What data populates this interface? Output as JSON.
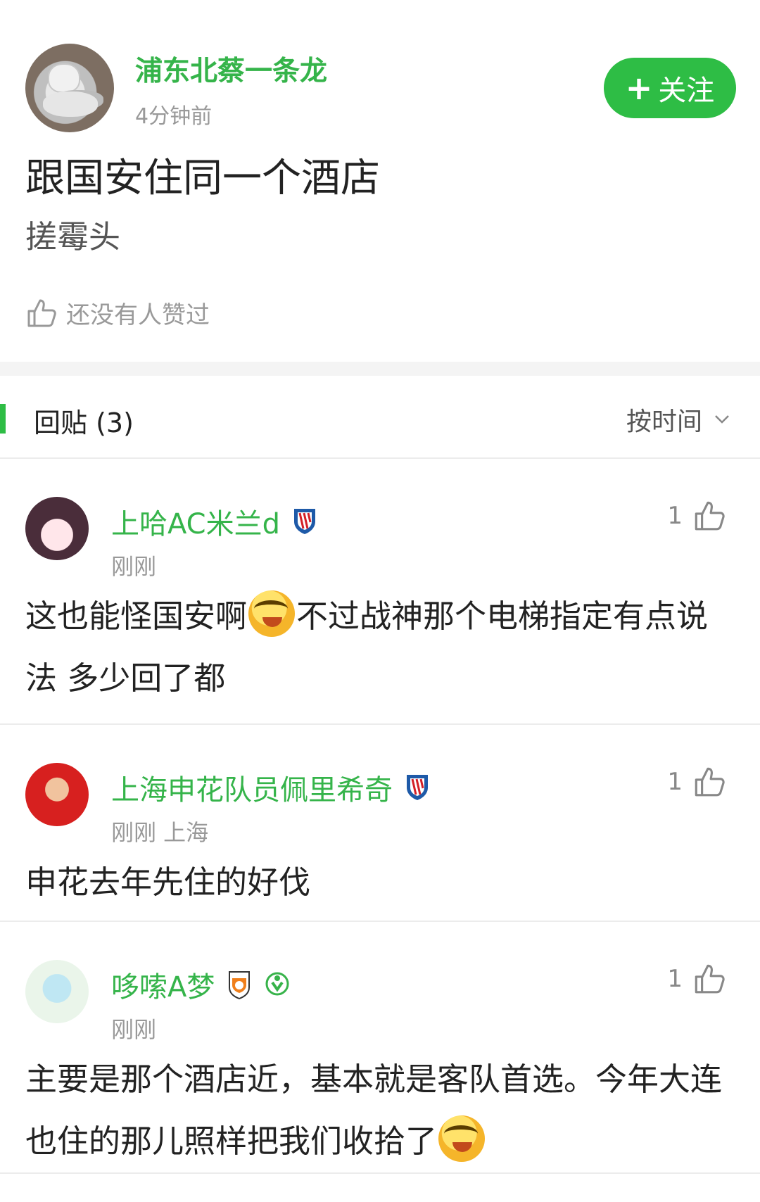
{
  "post": {
    "author": "浦东北蔡一条龙",
    "time": "4分钟前",
    "follow_label": "关注",
    "title": "跟国安住同一个酒店",
    "body": "搓霉头",
    "like_text": "还没有人赞过"
  },
  "replies": {
    "title": "回贴 (3)",
    "sort_label": "按时间",
    "items": [
      {
        "author": "上哈AC米兰d",
        "meta": "刚刚",
        "likes": "1",
        "text_part1": "这也能怪国安啊",
        "text_part2": "不过战神那个电梯指定有点说法 多少回了都"
      },
      {
        "author": "上海申花队员佩里希奇",
        "meta": "刚刚  上海",
        "likes": "1",
        "text": "申花去年先住的好伐"
      },
      {
        "author": "哆嗦A梦",
        "meta": "刚刚",
        "likes": "1",
        "text": "主要是那个酒店近，基本就是客队首选。今年大连也住的那儿照样把我们收拾了"
      }
    ]
  }
}
